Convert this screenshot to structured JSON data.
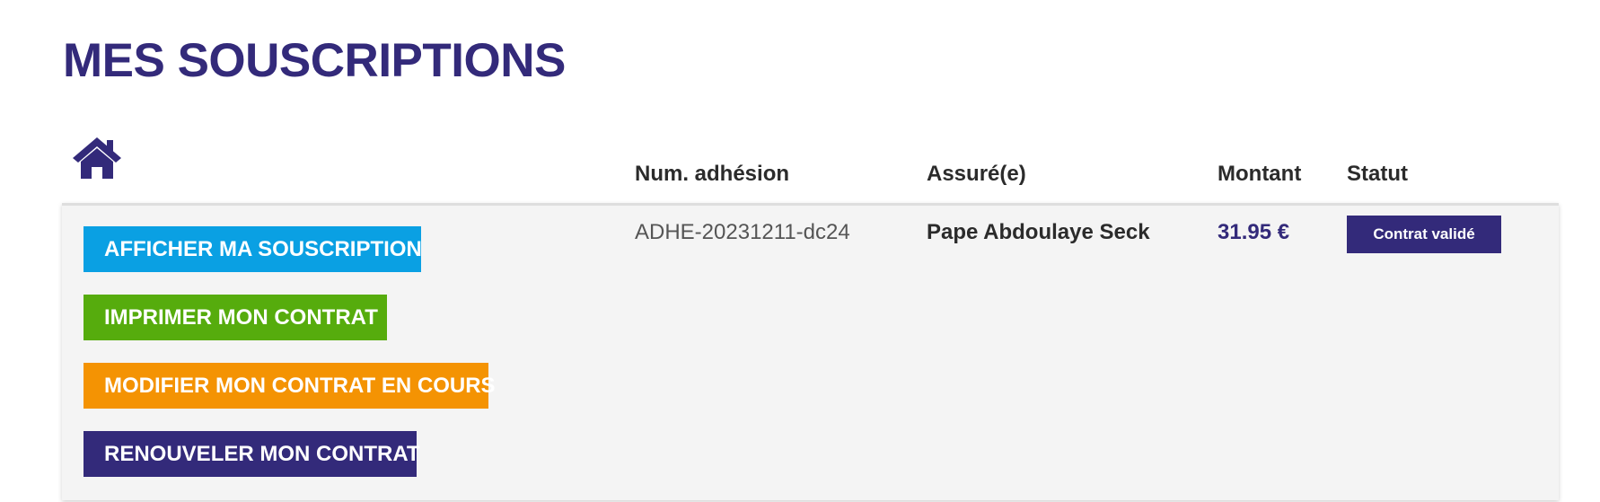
{
  "page": {
    "title": "MES SOUSCRIPTIONS"
  },
  "icons": {
    "home": "home-icon"
  },
  "colors": {
    "brand": "#332a7a",
    "afficher": "#0aa0e3",
    "imprimer": "#56ac0d",
    "modifier": "#f49303",
    "renouveler": "#332a7a",
    "panel": "#f4f4f4"
  },
  "table": {
    "headers": {
      "num_adhesion": "Num. adhésion",
      "assure": "Assuré(e)",
      "montant": "Montant",
      "statut": "Statut"
    },
    "rows": [
      {
        "actions": {
          "afficher": "AFFICHER MA SOUSCRIPTION",
          "imprimer": "IMPRIMER MON CONTRAT",
          "modifier": "MODIFIER MON CONTRAT EN COURS",
          "renouveler": "RENOUVELER MON CONTRAT"
        },
        "num_adhesion": "ADHE-20231211-dc24",
        "assure": "Pape Abdoulaye Seck",
        "montant": "31.95 €",
        "statut": "Contrat validé"
      }
    ]
  }
}
